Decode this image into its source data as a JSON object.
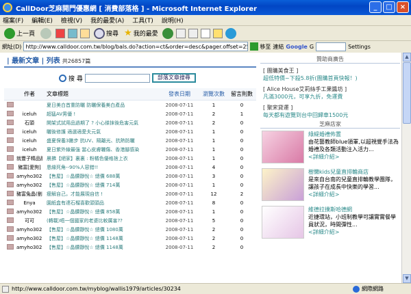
{
  "window": {
    "title": "CallDoor芝麻開門優惠網 [ 消費部落格 ] - Microsoft Internet Explorer"
  },
  "menu": [
    "檔案(F)",
    "編輯(E)",
    "檢視(V)",
    "我的最愛(A)",
    "工具(T)",
    "說明(H)"
  ],
  "toolbar": {
    "back": "上一頁",
    "search": "搜尋",
    "favorites": "我的最愛"
  },
  "address": {
    "label": "網址(D)",
    "url": "http://www.calldoor.com.tw/blog/bals.do?action=ct&order=desc&pager.offset=25",
    "go": "移至",
    "links": "連結",
    "search_engine": "Google",
    "g": "G",
    "settings": "Settings"
  },
  "main": {
    "heading": "| 最新文章 | 列表",
    "count": "共26857篇",
    "search_label": "搜 尋",
    "search_button": "部落文章搜尋",
    "columns": {
      "author": "作者",
      "title": "文章標題",
      "date": "發表日期",
      "views": "瀏覽次數",
      "comments": "留言則數"
    },
    "rows": [
      {
        "author": "",
        "title": "夏日美白首重防曬 防曬保養美白產品",
        "date": "2008-07-11",
        "views": "1",
        "comments": "0"
      },
      {
        "author": "iceluh",
        "title": "超猛AV男優 !",
        "date": "2008-07-11",
        "views": "2",
        "comments": "1"
      },
      {
        "author": "石頭",
        "title": "開架式試用品過期了 ? 小心搽抹後危害元氣",
        "date": "2008-07-11",
        "views": "2",
        "comments": "0"
      },
      {
        "author": "iceluh",
        "title": "曬後修護 適選適愛夫元氣",
        "date": "2008-07-11",
        "views": "1",
        "comments": "0"
      },
      {
        "author": "iceluh",
        "title": "盛夏保養3撇步 抗UV、隔離光、抗熱防曬",
        "date": "2008-07-11",
        "views": "1",
        "comments": "0"
      },
      {
        "author": "iceluh",
        "title": "夏日紫外線最強 當心皮膚曬傷、香港腳感染",
        "date": "2008-07-11",
        "views": "1",
        "comments": "0"
      },
      {
        "author": "就豐子精品服飾",
        "title": "晨拂【絕家】裏裏 : 粉橘色優格捨上衣",
        "date": "2008-07-11",
        "views": "1",
        "comments": "0"
      },
      {
        "author": "豬富[愛狗]",
        "title": "恩緣死角--90%人容錯!!",
        "date": "2008-07-11",
        "views": "4",
        "comments": "0"
      },
      {
        "author": "amyho30230",
        "title": "【售屋】☆晶鑽靜悅☆ 總價 688萬",
        "date": "2008-07-11",
        "views": "3",
        "comments": "0"
      },
      {
        "author": "amyho30230",
        "title": "【售屋】☆晶鑽靜悅☆ 總價 714萬",
        "date": "2008-07-11",
        "views": "1",
        "comments": "0"
      },
      {
        "author": "豬富兔晶(劉小姐)",
        "title": "瘦解自己，才能展現自信 !",
        "date": "2008-07-11",
        "views": "12",
        "comments": "2"
      },
      {
        "author": "Enya",
        "title": "園紙盒有達石榴喜歡頭頭品",
        "date": "2008-07-11",
        "views": "8",
        "comments": "0"
      },
      {
        "author": "amyho30230",
        "title": "【售屋】☆晶鑽靜悅☆ 總價 858萬",
        "date": "2008-07-11",
        "views": "1",
        "comments": "0"
      },
      {
        "author": "可可",
        "title": "(轉載)唔一個國家的老婆比較厲害??",
        "date": "2008-07-11",
        "views": "5",
        "comments": "0"
      },
      {
        "author": "amyho30230",
        "title": "【售屋】☆晶鑽靜悅☆ 總價 1080萬",
        "date": "2008-07-11",
        "views": "2",
        "comments": "0"
      },
      {
        "author": "amyho30230",
        "title": "【售屋】☆晶鑽靜悅☆ 總價 1148萬",
        "date": "2008-07-11",
        "views": "2",
        "comments": "0"
      },
      {
        "author": "amyho30230",
        "title": "【售屋】☆晶鑽靜悅☆ 總價 1148萬",
        "date": "2008-07-11",
        "views": "2",
        "comments": "0"
      }
    ]
  },
  "sidebar": {
    "sponsor_title": "贊助商廣告",
    "ads": [
      {
        "title": "[ 團購美食王 ]",
        "link": "超低特價~下殺5.8折(團購首頁快報！)"
      },
      {
        "title": "[ Alice House艾莉絲手工果醬坊 ]",
        "link": "凡滿3000元，可享九折，免運費"
      },
      {
        "title": "[ 聚宋貸運 ]",
        "link": "每天都有遊覽到台中回歸車1500元"
      }
    ],
    "stores_title": "芝麻店家",
    "stores": [
      {
        "name": "綠緹婚禮佈置",
        "desc": "由花藝教師blue領軍,以超視覺手法為婚禮及各類活動注入活力...",
        "more": "<詳細介紹>"
      },
      {
        "name": "樹懶kids兒童直排輪商店",
        "desc": "是來自台南的兒童直排輪教學團隊，讓孩子在成長中快樂的學習...",
        "more": "<詳細介紹>"
      },
      {
        "name": "維德拉撲斯哈德網",
        "desc": "近捷環站，小班制教學可讓實實餐學員狀況，時間彈性...",
        "more": "<詳細介紹>"
      }
    ]
  },
  "status": {
    "url": "http://www.calldoor.com.tw/myblog/wallis1979/articles/30234",
    "zone": "網際網路"
  }
}
